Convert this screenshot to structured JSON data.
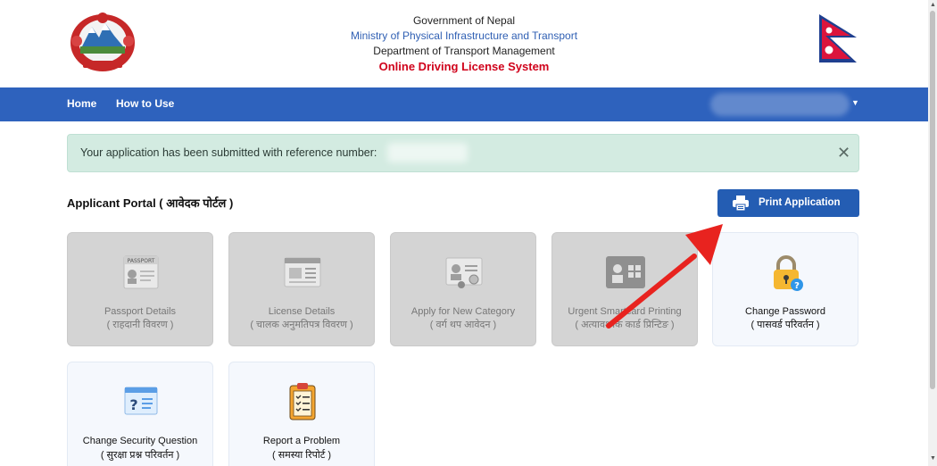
{
  "header": {
    "line1": "Government of Nepal",
    "line2": "Ministry of Physical Infrastructure and Transport",
    "line3": "Department of Transport Management",
    "line4": "Online Driving License System"
  },
  "nav": {
    "home": "Home",
    "how_to_use": "How to Use"
  },
  "alert": {
    "message": "Your application has been submitted with reference number:",
    "close": "✕"
  },
  "portal": {
    "title": "Applicant Portal ( आवेदक पोर्टल )",
    "print_button": "Print Application"
  },
  "cards": [
    {
      "title": "Passport Details",
      "subtitle": "( राहदानी विवरण )",
      "icon": "passport-icon",
      "enabled": false
    },
    {
      "title": "License Details",
      "subtitle": "( चालक अनुमतिपत्र विवरण )",
      "icon": "license-icon",
      "enabled": false
    },
    {
      "title": "Apply for New Category",
      "subtitle": "( वर्ग थप आवेदन )",
      "icon": "new-category-icon",
      "enabled": false
    },
    {
      "title": "Urgent Smartcard Printing",
      "subtitle": "( अत्यावश्यक कार्ड प्रिन्टिङ )",
      "icon": "smartcard-icon",
      "enabled": false
    },
    {
      "title": "Change Password",
      "subtitle": "( पासवर्ड परिवर्तन )",
      "icon": "lock-icon",
      "enabled": true
    },
    {
      "title": "Change Security Question",
      "subtitle": "( सुरक्षा प्रश्न परिवर्तन )",
      "icon": "security-question-icon",
      "enabled": true
    },
    {
      "title": "Report a Problem",
      "subtitle": "( समस्या रिपोर्ट )",
      "icon": "clipboard-icon",
      "enabled": true
    }
  ],
  "colors": {
    "nav_blue": "#2e62bd",
    "button_blue": "#245db3",
    "alert_green": "#d3ebe1",
    "accent_red": "#d0021b",
    "annotation_arrow": "#e8231f"
  }
}
